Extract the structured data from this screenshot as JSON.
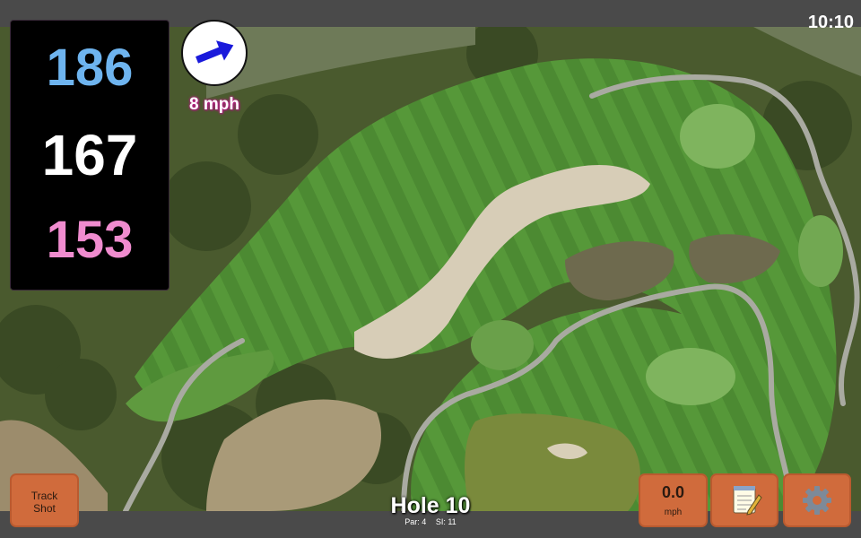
{
  "status": {
    "time": "10:10"
  },
  "distances": {
    "back": {
      "value": "186",
      "color": "#6eb4ef"
    },
    "middle": {
      "value": "167",
      "color": "#ffffff"
    },
    "front": {
      "value": "153",
      "color": "#f08ccf"
    }
  },
  "wind": {
    "speed_label": "8 mph",
    "arrow_color": "#1a1adb",
    "icon": "wind-arrow-icon"
  },
  "hole": {
    "title": "Hole 10",
    "par": "Par: 4",
    "stroke_index": "SI: 11"
  },
  "buttons": {
    "track_line1": "Track",
    "track_line2": "Shot",
    "speed_value": "0.0",
    "speed_unit": "mph",
    "notes_icon": "notepad-icon",
    "settings_icon": "gear-icon",
    "accent": "#d06b3c"
  }
}
